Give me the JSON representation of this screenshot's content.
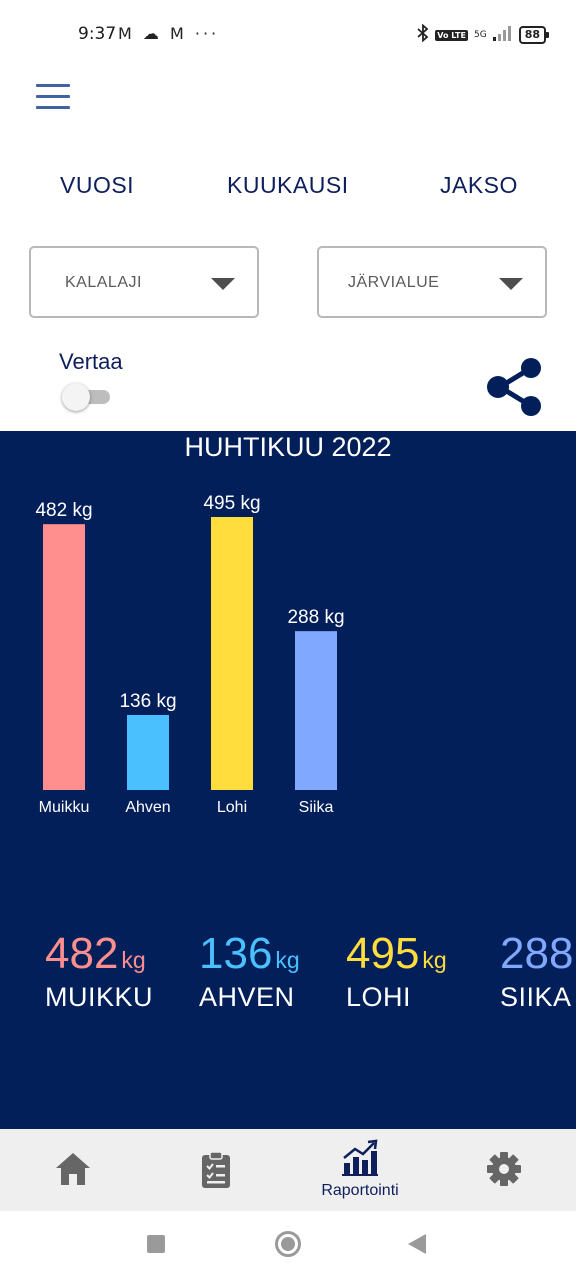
{
  "status_bar": {
    "time": "9:37",
    "left_icons": "M ☁ M ···",
    "network": "5G",
    "volte": "Vo LTE",
    "battery": "88"
  },
  "tabs": [
    {
      "label": "VUOSI"
    },
    {
      "label": "KUUKAUSI"
    },
    {
      "label": "JAKSO"
    }
  ],
  "filters": {
    "species_label": "KALALAJI",
    "lake_label": "JÄRVIALUE"
  },
  "compare": {
    "label": "Vertaa",
    "enabled": false
  },
  "report": {
    "title": "HUHTIKUU 2022"
  },
  "chart_data": {
    "type": "bar",
    "title": "HUHTIKUU 2022",
    "categories": [
      "Muikku",
      "Ahven",
      "Lohi",
      "Siika"
    ],
    "values": [
      482,
      136,
      495,
      288
    ],
    "value_labels": [
      "482 kg",
      "136 kg",
      "495 kg",
      "288 kg"
    ],
    "colors": [
      "#ff8f8f",
      "#4bc0ff",
      "#ffdd3c",
      "#80a8ff"
    ],
    "unit": "kg",
    "ylim": [
      0,
      495
    ],
    "grid": false,
    "legend": "none"
  },
  "summary": [
    {
      "value": "482",
      "unit": "kg",
      "name": "MUIKKU",
      "color": "#ff8f8f"
    },
    {
      "value": "136",
      "unit": "kg",
      "name": "AHVEN",
      "color": "#4bc0ff"
    },
    {
      "value": "495",
      "unit": "kg",
      "name": "LOHI",
      "color": "#ffdd3c"
    },
    {
      "value": "288",
      "unit": "",
      "name": "SIIKA",
      "color": "#80a8ff"
    }
  ],
  "bottom_nav": {
    "report_label": "Raportointi",
    "active_color": "#0e1f5b",
    "icon_color": "#666666"
  }
}
